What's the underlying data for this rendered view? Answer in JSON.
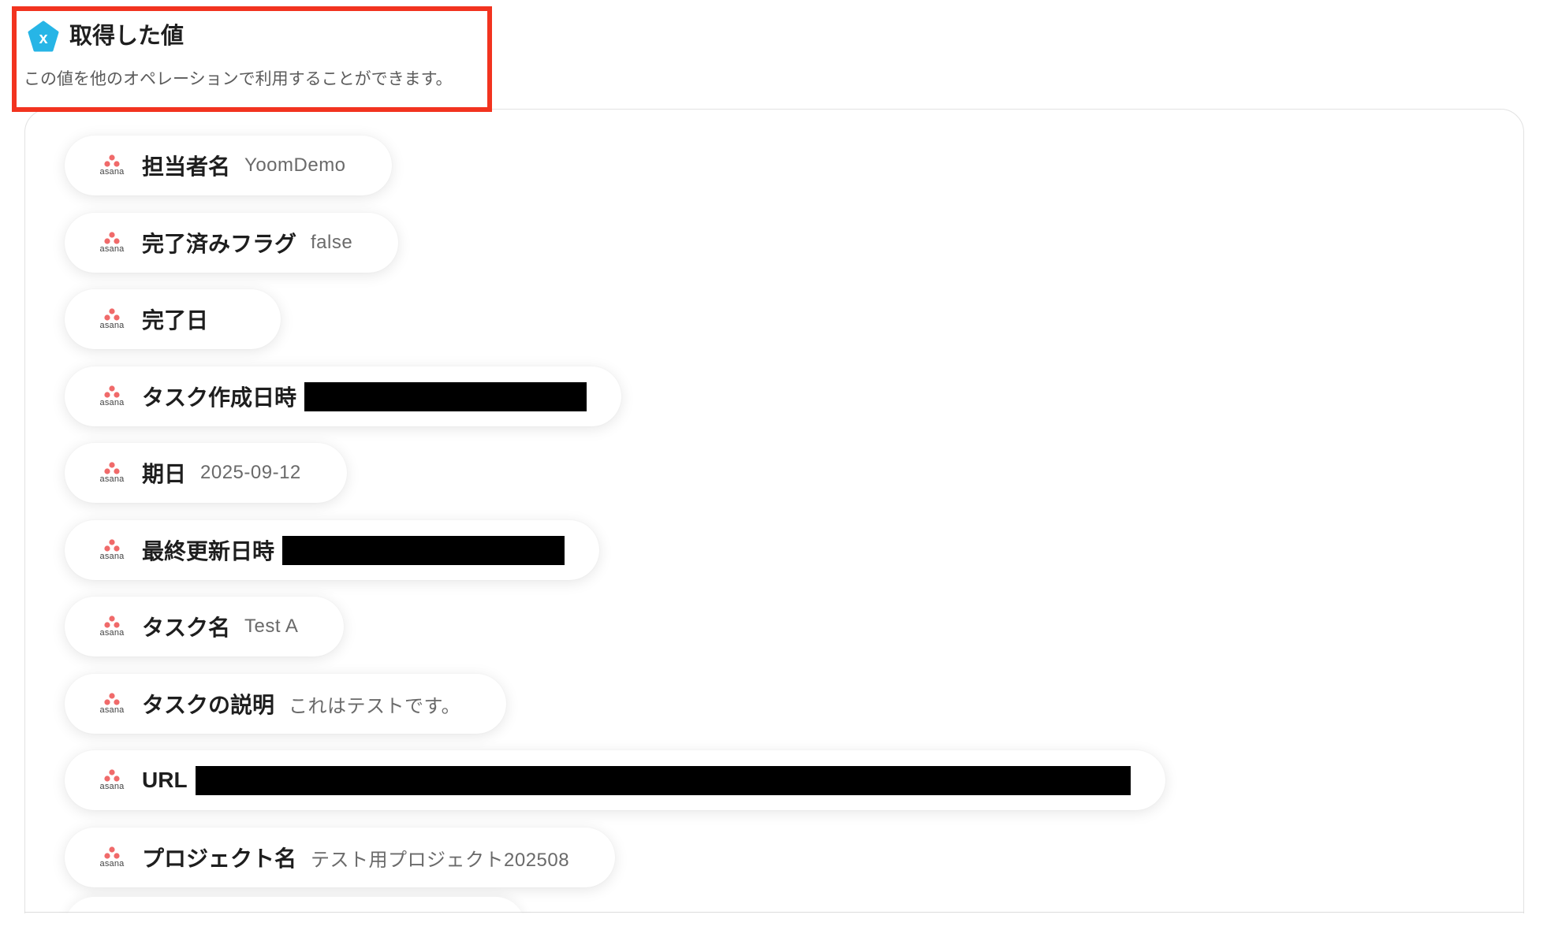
{
  "header": {
    "title": "取得した値",
    "description": "この値を他のオペレーションで利用することができます。",
    "icon": "yoom-x-icon",
    "icon_color": "#27b5e6",
    "highlight_color": "#f2331f"
  },
  "values": [
    {
      "label": "担当者名",
      "value": "YoomDemo",
      "redacted": false
    },
    {
      "label": "完了済みフラグ",
      "value": "false",
      "redacted": false
    },
    {
      "label": "完了日",
      "value": "",
      "redacted": false
    },
    {
      "label": "タスク作成日時",
      "value": "",
      "redacted": true
    },
    {
      "label": "期日",
      "value": "2025-09-12",
      "redacted": false
    },
    {
      "label": "最終更新日時",
      "value": "",
      "redacted": true
    },
    {
      "label": "タスク名",
      "value": "Test A",
      "redacted": false
    },
    {
      "label": "タスクの説明",
      "value": "これはテストです。",
      "redacted": false
    },
    {
      "label": "URL",
      "value": "",
      "redacted": true
    },
    {
      "label": "プロジェクト名",
      "value": "テスト用プロジェクト202508",
      "redacted": false
    }
  ],
  "app_logo": {
    "name": "asana-logo",
    "text": "asana",
    "color": "#f06a6a"
  }
}
